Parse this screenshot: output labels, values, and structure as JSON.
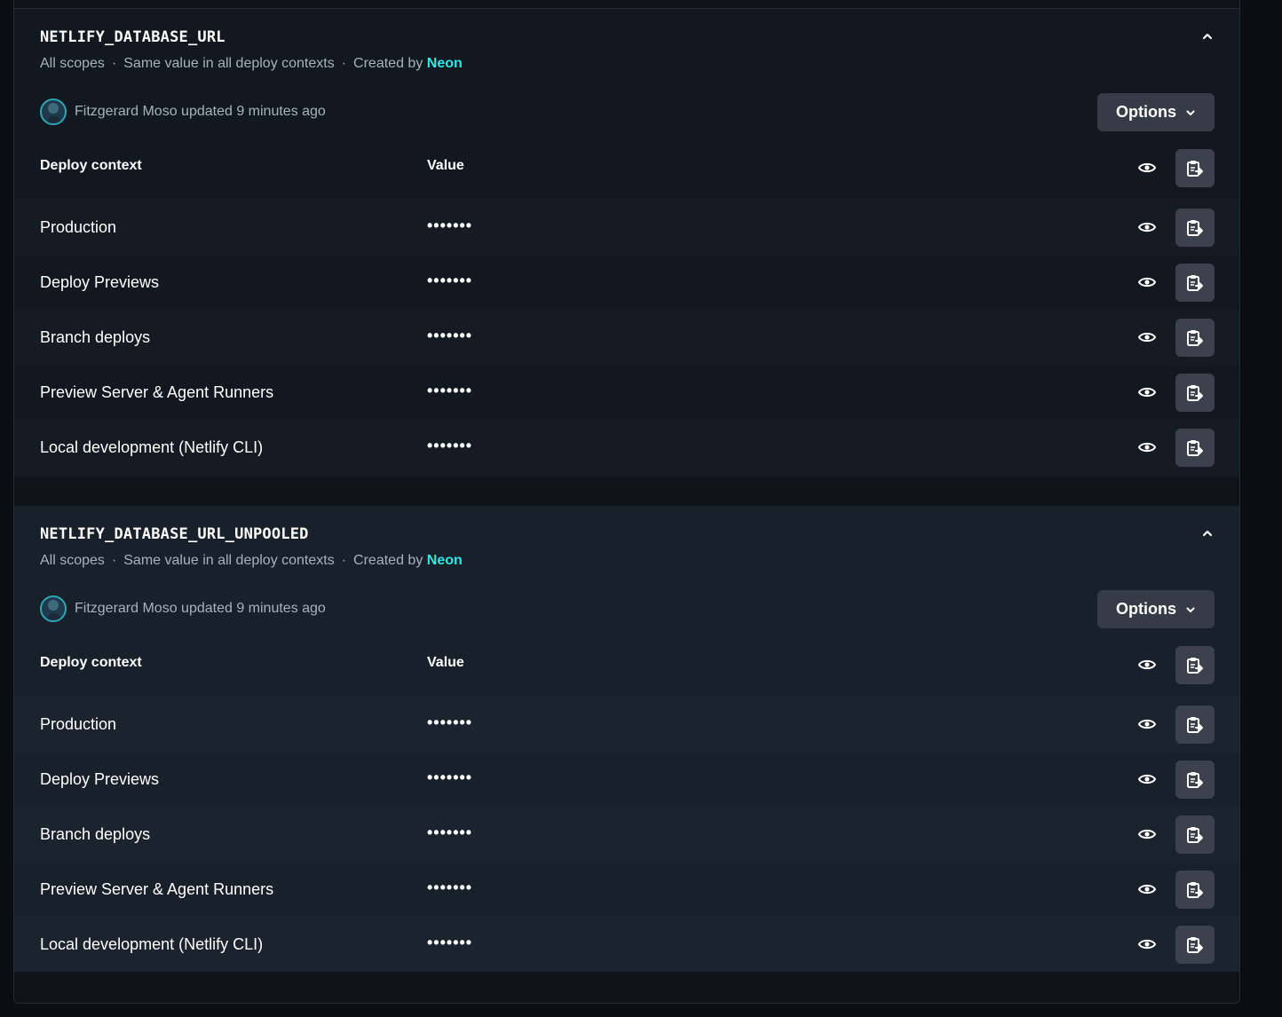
{
  "variables": [
    {
      "name": "NETLIFY_DATABASE_URL",
      "scope": "All scopes",
      "contexts_note": "Same value in all deploy contexts",
      "created_by_label": "Created by",
      "created_by": "Neon",
      "updater_text": "Fitzgerard Moso updated 9 minutes ago",
      "options_label": "Options",
      "col_context": "Deploy context",
      "col_value": "Value",
      "rows": [
        {
          "context": "Production",
          "value": "•••••••"
        },
        {
          "context": "Deploy Previews",
          "value": "•••••••"
        },
        {
          "context": "Branch deploys",
          "value": "•••••••"
        },
        {
          "context": "Preview Server & Agent Runners",
          "value": "•••••••"
        },
        {
          "context": "Local development (Netlify CLI)",
          "value": "•••••••"
        }
      ]
    },
    {
      "name": "NETLIFY_DATABASE_URL_UNPOOLED",
      "scope": "All scopes",
      "contexts_note": "Same value in all deploy contexts",
      "created_by_label": "Created by",
      "created_by": "Neon",
      "updater_text": "Fitzgerard Moso updated 9 minutes ago",
      "options_label": "Options",
      "col_context": "Deploy context",
      "col_value": "Value",
      "rows": [
        {
          "context": "Production",
          "value": "•••••••"
        },
        {
          "context": "Deploy Previews",
          "value": "•••••••"
        },
        {
          "context": "Branch deploys",
          "value": "•••••••"
        },
        {
          "context": "Preview Server & Agent Runners",
          "value": "•••••••"
        },
        {
          "context": "Local development (Netlify CLI)",
          "value": "•••••••"
        }
      ]
    }
  ],
  "icons": {
    "collapse": "chevron-up-icon",
    "options": "chevron-down-icon",
    "reveal": "eye-icon",
    "copy": "clipboard-copy-icon"
  },
  "colors": {
    "accent": "#32e6e2",
    "button_bg": "#353c46"
  }
}
